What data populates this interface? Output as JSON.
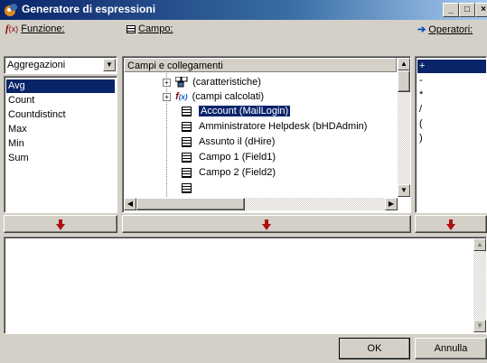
{
  "window": {
    "title": "Generatore di espressioni"
  },
  "funzione": {
    "label": "Funzione:",
    "dropdown_value": "Aggregazioni",
    "items": [
      "Avg",
      "Count",
      "Countdistinct",
      "Max",
      "Min",
      "Sum"
    ],
    "selected": "Avg"
  },
  "campo": {
    "label": "Campo:",
    "header": "Campi e collegamenti",
    "tree": [
      {
        "text": "(caratteristiche)",
        "expandable": true,
        "icon": "characteristics-icon"
      },
      {
        "text": "(campi calcolati)",
        "expandable": true,
        "icon": "calculated-fields-icon"
      },
      {
        "text": "Account (MailLogin)",
        "selected": true,
        "icon": "field-icon"
      },
      {
        "text": "Amministratore Helpdesk (bHDAdmin)",
        "icon": "field-icon"
      },
      {
        "text": "Assunto il (dHire)",
        "icon": "field-icon"
      },
      {
        "text": "Campo 1 (Field1)",
        "icon": "field-icon"
      },
      {
        "text": "Campo 2 (Field2)",
        "icon": "field-icon"
      }
    ]
  },
  "operatori": {
    "label": "Operatori:",
    "items": [
      "+",
      "-",
      "*",
      "/",
      "(",
      ")"
    ],
    "selected": "+"
  },
  "buttons": {
    "ok": "OK",
    "cancel": "Annulla"
  },
  "colors": {
    "title_bar": "#0a246a",
    "selection": "#0a246a",
    "insert_arrow": "#b01010"
  }
}
